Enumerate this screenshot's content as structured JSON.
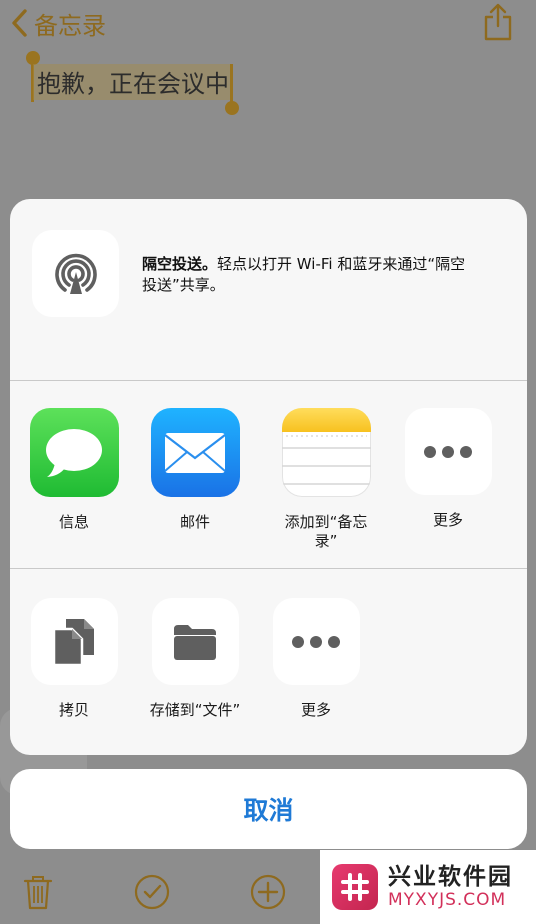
{
  "nav": {
    "back_label": "备忘录"
  },
  "note": {
    "selected_text": "抱歉，正在会议中"
  },
  "share_sheet": {
    "airdrop": {
      "title": "隔空投送。",
      "description_line1": "轻点以打开 Wi-Fi 和蓝牙来通过“隔空",
      "description_line2": "投送”共享。",
      "icon": "airdrop-icon"
    },
    "apps": [
      {
        "label": "信息",
        "icon": "messages-icon",
        "color": "#34c53d"
      },
      {
        "label": "邮件",
        "icon": "mail-icon",
        "color": "#1e8ef3"
      },
      {
        "label_line1": "添加到“备忘",
        "label_line2": "录”",
        "icon": "notes-icon",
        "color": "#ffd23a"
      },
      {
        "label": "更多",
        "icon": "more-icon"
      }
    ],
    "actions": [
      {
        "label": "拷贝",
        "icon": "copy-icon"
      },
      {
        "label": "存储到“文件”",
        "icon": "folder-icon"
      },
      {
        "label": "更多",
        "icon": "more-icon"
      }
    ],
    "cancel_label": "取消"
  },
  "toolbar": {
    "icons": [
      "trash-icon",
      "checklist-icon",
      "add-icon"
    ]
  },
  "watermark": {
    "cn": "兴业软件园",
    "en": "MYXYJS.COM"
  },
  "colors": {
    "accent": "#1f7ad6",
    "notes_gold": "#9a7420"
  }
}
